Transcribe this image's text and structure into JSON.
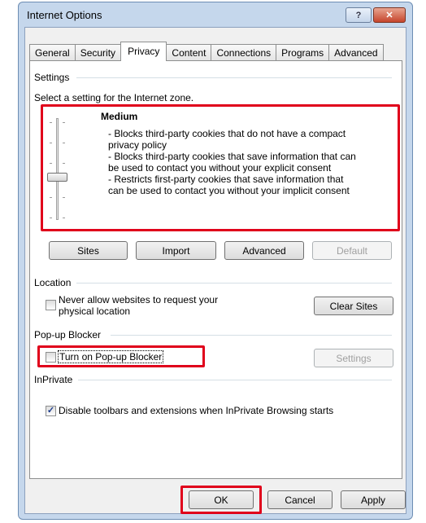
{
  "window": {
    "title": "Internet Options",
    "help_symbol": "?",
    "close_symbol": "✕"
  },
  "tabs": [
    "General",
    "Security",
    "Privacy",
    "Content",
    "Connections",
    "Programs",
    "Advanced"
  ],
  "settings": {
    "group_label": "Settings",
    "prompt": "Select a setting for the Internet zone.",
    "level_title": "Medium",
    "level_lines": [
      "- Blocks third-party cookies that do not have a compact",
      "privacy policy",
      "- Blocks third-party cookies that save information that can",
      "be used to contact you without your explicit consent",
      "- Restricts first-party cookies that save information that",
      "can be used to contact you without your implicit consent"
    ],
    "buttons": {
      "sites": "Sites",
      "import": "Import",
      "advanced": "Advanced",
      "default": "Default"
    }
  },
  "location": {
    "group_label": "Location",
    "checkbox_line1": "Never allow websites to request your",
    "checkbox_line2": "physical location",
    "clear_sites": "Clear Sites"
  },
  "popup": {
    "group_label": "Pop-up Blocker",
    "checkbox_label": "Turn on Pop-up Blocker",
    "settings_button": "Settings"
  },
  "inprivate": {
    "group_label": "InPrivate",
    "checkbox_label": "Disable toolbars and extensions when InPrivate Browsing starts",
    "check_mark": "✓"
  },
  "footer": {
    "ok": "OK",
    "cancel": "Cancel",
    "apply": "Apply"
  },
  "colors": {
    "highlight": "#e0001b",
    "frame": "#c5d7ec"
  }
}
